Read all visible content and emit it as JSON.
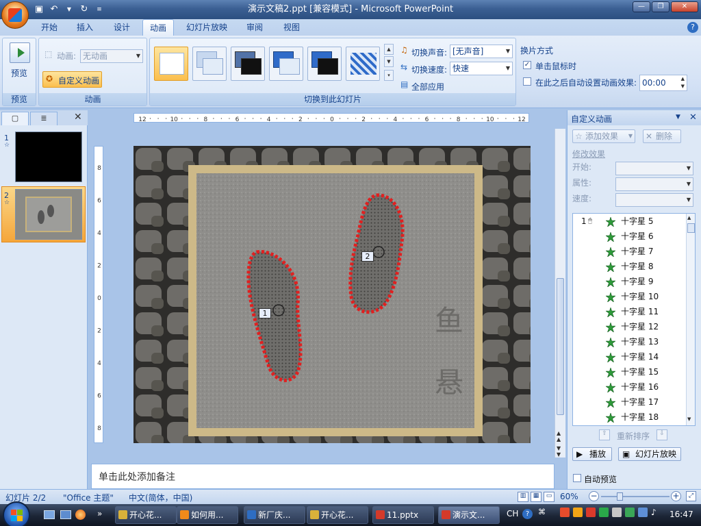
{
  "window": {
    "title": "演示文稿2.ppt [兼容模式] - Microsoft PowerPoint"
  },
  "tabs": [
    "开始",
    "插入",
    "设计",
    "动画",
    "幻灯片放映",
    "审阅",
    "视图"
  ],
  "ribbon": {
    "preview_group": {
      "button": "预览",
      "label": "预览"
    },
    "animation_group": {
      "anim_label": "动画:",
      "anim_value": "无动画",
      "custom_button": "自定义动画",
      "label": "动画"
    },
    "transition_group": {
      "sound_label": "切换声音:",
      "sound_value": "[无声音]",
      "speed_label": "切换速度:",
      "speed_value": "快速",
      "apply_all": "全部应用",
      "label": "切换到此幻灯片"
    },
    "advance": {
      "title": "换片方式",
      "on_click": "单击鼠标时",
      "after": "在此之后自动设置动画效果:",
      "time": "00:00"
    }
  },
  "left_pane": {
    "slide1_num": "1",
    "slide2_num": "2"
  },
  "ruler": {
    "h_labels": [
      "12",
      "10",
      "8",
      "6",
      "4",
      "2",
      "0",
      "2",
      "4",
      "6",
      "8",
      "10",
      "12"
    ],
    "v_labels": [
      "8",
      "6",
      "4",
      "2",
      "0",
      "2",
      "4",
      "6",
      "8"
    ]
  },
  "slide": {
    "markers": [
      "1",
      "2"
    ],
    "calligraphy": "鱼 悬"
  },
  "notes": {
    "placeholder": "单击此处添加备注"
  },
  "custom_anim": {
    "title": "自定义动画",
    "add_effect": "添加效果",
    "remove": "删除",
    "modify_title": "修改效果",
    "start_label": "开始:",
    "property_label": "属性:",
    "speed_label": "速度:",
    "first_index": "1",
    "items": [
      "十字星 5",
      "十字星 6",
      "十字星 7",
      "十字星 8",
      "十字星 9",
      "十字星 10",
      "十字星 11",
      "十字星 12",
      "十字星 13",
      "十字星 14",
      "十字星 15",
      "十字星 16",
      "十字星 17",
      "十字星 18"
    ],
    "reorder": "重新排序",
    "play": "播放",
    "slideshow": "幻灯片放映",
    "auto_preview": "自动预览"
  },
  "status": {
    "slide": "幻灯片 2/2",
    "theme": "\"Office 主题\"",
    "lang": "中文(简体，中国)",
    "zoom": "60%"
  },
  "taskbar": {
    "items": [
      "开心花...",
      "如何用...",
      "新厂庆...",
      "开心花...",
      "11.pptx",
      "演示文..."
    ],
    "lang": "CH",
    "clock": "16:47"
  },
  "colors": {
    "accent": "#15428b",
    "ribbon_bg": "#dce8f7",
    "selection": "#fbbf4e",
    "taskbar": "#1c2536"
  }
}
